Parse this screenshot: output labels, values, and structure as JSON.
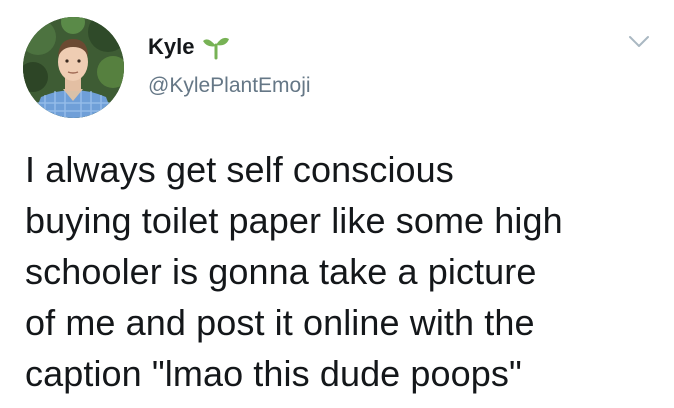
{
  "author": {
    "display_name": "Kyle",
    "handle": "@KylePlantEmoji",
    "name_emoji_icon": "seedling-icon",
    "avatar_icon": "profile-photo"
  },
  "tweet": {
    "lines": [
      "I always get self conscious",
      "buying toilet paper like some high",
      "schooler is gonna take a picture",
      "of me and post it online with the",
      "caption \"lmao this dude poops\""
    ]
  },
  "menu_icon": "chevron-down-icon",
  "colors": {
    "text": "#14171a",
    "handle": "#657786",
    "seedling": "#77b255",
    "caret": "#aab8c2"
  }
}
